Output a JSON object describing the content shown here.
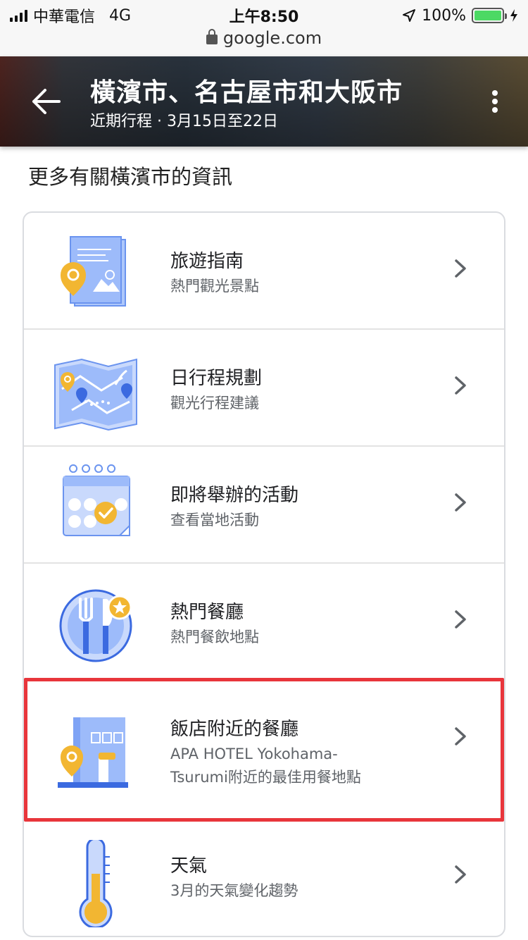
{
  "status": {
    "carrier": "中華電信",
    "network": "4G",
    "time": "上午8:50",
    "battery": "100%",
    "url": "google.com"
  },
  "header": {
    "title": "橫濱市、名古屋市和大阪市",
    "subtitle": "近期行程 · 3月15日至22日"
  },
  "section_title": "更多有關橫濱市的資訊",
  "items": [
    {
      "title": "旅遊指南",
      "subtitle": "熱門觀光景點",
      "icon": "travel-guide-icon"
    },
    {
      "title": "日行程規劃",
      "subtitle": "觀光行程建議",
      "icon": "map-icon"
    },
    {
      "title": "即將舉辦的活動",
      "subtitle": "查看當地活動",
      "icon": "calendar-icon"
    },
    {
      "title": "熱門餐廳",
      "subtitle": "熱門餐飲地點",
      "icon": "restaurant-icon"
    },
    {
      "title": "飯店附近的餐廳",
      "subtitle_line1": "APA HOTEL Yokohama-",
      "subtitle_line2": "Tsurumi附近的最佳用餐地點",
      "icon": "hotel-icon"
    },
    {
      "title": "天氣",
      "subtitle": "3月的天氣變化趨勢",
      "icon": "thermometer-icon"
    }
  ],
  "colors": {
    "accent_blue": "#7ea3f5",
    "pin_yellow": "#f2b632",
    "highlight_red": "#e8353b",
    "battery_green": "#4cd964"
  }
}
